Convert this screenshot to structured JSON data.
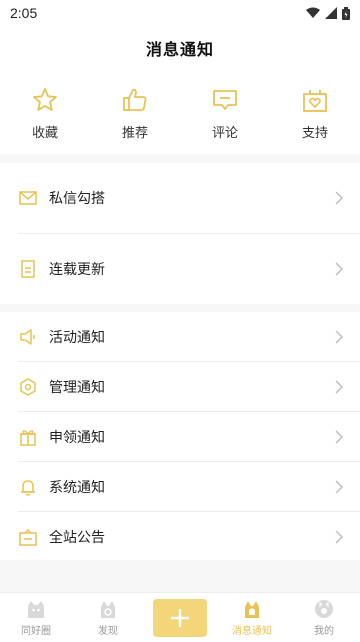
{
  "status": {
    "time": "2:05"
  },
  "header": {
    "title": "消息通知"
  },
  "quick": [
    {
      "label": "收藏",
      "icon": "star-icon"
    },
    {
      "label": "推荐",
      "icon": "thumbs-up-icon"
    },
    {
      "label": "评论",
      "icon": "comment-icon"
    },
    {
      "label": "支持",
      "icon": "gift-heart-icon"
    }
  ],
  "group1": [
    {
      "label": "私信勾搭",
      "icon": "mail-icon"
    },
    {
      "label": "连载更新",
      "icon": "document-icon"
    }
  ],
  "group2": [
    {
      "label": "活动通知",
      "icon": "megaphone-icon"
    },
    {
      "label": "管理通知",
      "icon": "hexagon-icon"
    },
    {
      "label": "申领通知",
      "icon": "gift-icon"
    },
    {
      "label": "系统通知",
      "icon": "bell-icon"
    },
    {
      "label": "全站公告",
      "icon": "announcement-icon"
    }
  ],
  "tabs": [
    {
      "label": "同好圈"
    },
    {
      "label": "发现"
    },
    {
      "label": "消息通知"
    },
    {
      "label": "我的"
    }
  ],
  "colors": {
    "accent": "#e8c255",
    "accent_light": "#f3d67a",
    "tab_inactive": "#999999"
  }
}
